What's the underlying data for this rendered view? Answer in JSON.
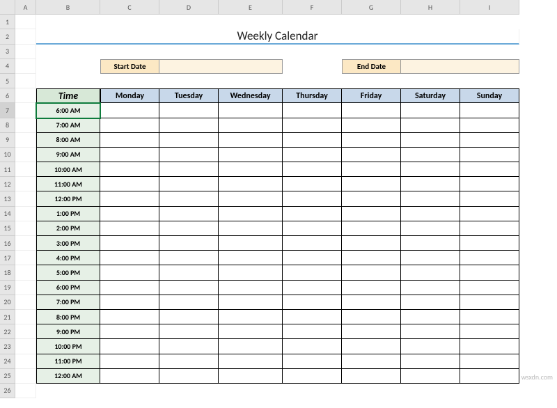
{
  "colHeaders": [
    "A",
    "B",
    "C",
    "D",
    "E",
    "F",
    "G",
    "H",
    "I"
  ],
  "rowCount": 26,
  "selectedRow": 7,
  "title": "Weekly Calendar",
  "labels": {
    "startDate": "Start Date",
    "endDate": "End Date",
    "time": "Time"
  },
  "days": [
    "Monday",
    "Tuesday",
    "Wednesday",
    "Thursday",
    "Friday",
    "Saturday",
    "Sunday"
  ],
  "times": [
    "6:00 AM",
    "7:00 AM",
    "8:00 AM",
    "9:00 AM",
    "10:00 AM",
    "11:00 AM",
    "12:00 PM",
    "1:00 PM",
    "2:00 PM",
    "3:00 PM",
    "4:00 PM",
    "5:00 PM",
    "6:00 PM",
    "7:00 PM",
    "8:00 PM",
    "9:00 PM",
    "10:00 PM",
    "11:00 PM",
    "12:00 AM"
  ],
  "startDateValue": "",
  "endDateValue": "",
  "watermark": "wsxdn.com"
}
